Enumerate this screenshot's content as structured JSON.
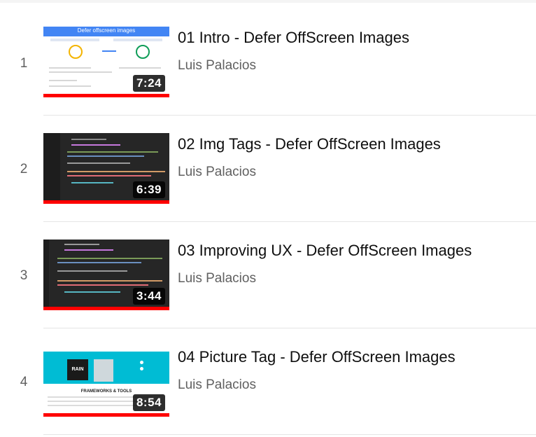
{
  "playlist": {
    "items": [
      {
        "index": "1",
        "title": "01 Intro - Defer OffScreen Images",
        "channel": "Luis Palacios",
        "duration": "7:24",
        "watched_fraction": 1.0,
        "thumbnail": {
          "heading": "Defer offscreen images"
        }
      },
      {
        "index": "2",
        "title": "02 Img Tags - Defer OffScreen Images",
        "channel": "Luis Palacios",
        "duration": "6:39",
        "watched_fraction": 1.0
      },
      {
        "index": "3",
        "title": "03 Improving UX - Defer OffScreen Images",
        "channel": "Luis Palacios",
        "duration": "3:44",
        "watched_fraction": 1.0
      },
      {
        "index": "4",
        "title": "04 Picture Tag - Defer OffScreen Images",
        "channel": "Luis Palacios",
        "duration": "8:54",
        "watched_fraction": 1.0,
        "thumbnail": {
          "badge": "RAIN",
          "caption": "FRAMEWORKS & TOOLS"
        }
      }
    ]
  },
  "colors": {
    "progress": "#ff0000",
    "title": "#0f0f0f",
    "secondary": "#606060",
    "thumb_banner_blue": "#4285f4",
    "thumb_banner_cyan": "#00bcd4"
  }
}
